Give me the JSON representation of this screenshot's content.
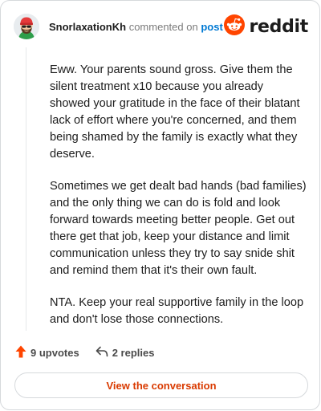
{
  "header": {
    "author": "SnorlaxationKh",
    "commented_on": "commented on",
    "post_link": "post",
    "brand": "reddit"
  },
  "comment": {
    "paragraphs": [
      "Eww. Your parents sound gross. Give them the silent treatment x10 because you already showed your gratitude in the face of their blatant lack of effort where you're concerned, and them being shamed by the family is exactly what they deserve.",
      "Sometimes we get dealt bad hands (bad families) and the only thing we can do is fold and look forward towards meeting better people. Get out there get that job, keep your distance and limit communication unless they try to say snide shit and remind them that it's their own fault.",
      "NTA. Keep your real supportive family in the loop and don't lose those connections."
    ]
  },
  "actions": {
    "upvotes": "9 upvotes",
    "replies": "2 replies"
  },
  "cta": {
    "label": "View the conversation"
  },
  "colors": {
    "accent": "#ff4500",
    "link": "#0079d3",
    "cta_text": "#d93a00"
  },
  "icons": {
    "upvote": "arrow-up-icon",
    "reply": "reply-arrow-icon",
    "logo": "reddit-snoo-icon"
  }
}
